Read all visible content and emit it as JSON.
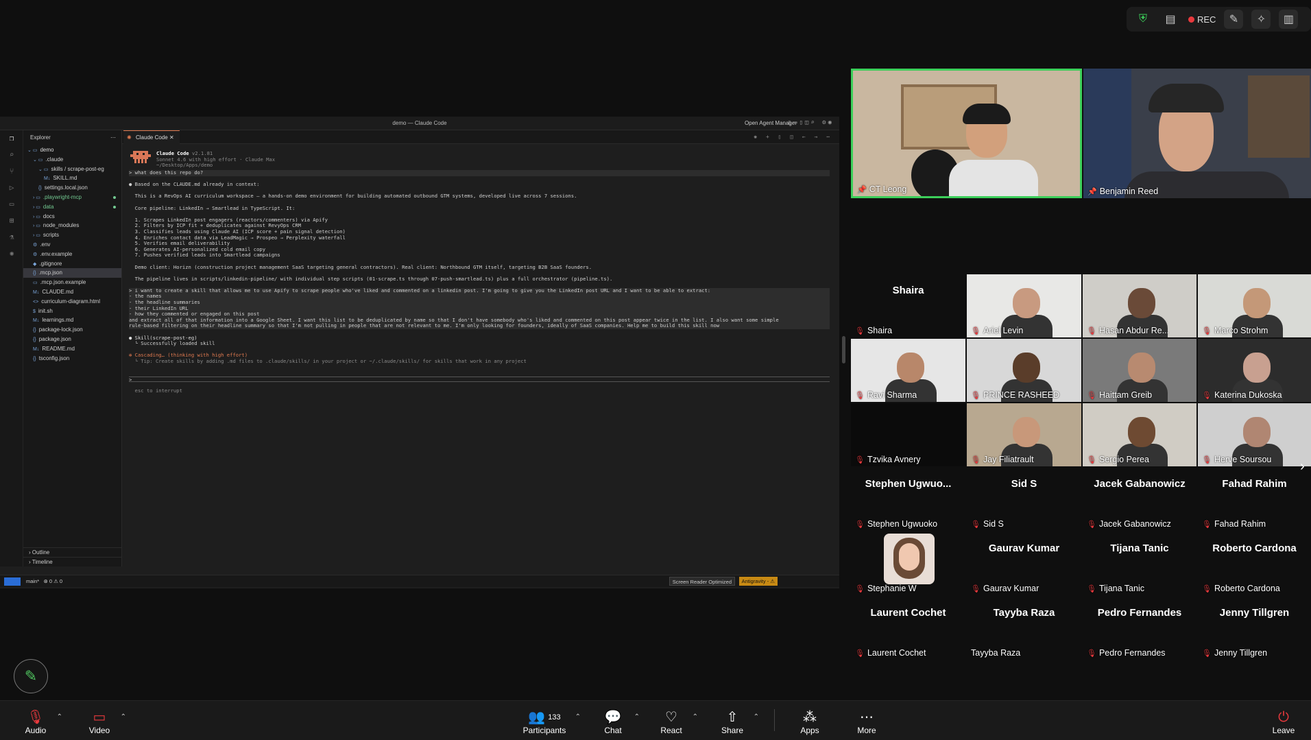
{
  "top_controls": {
    "rec_label": "REC"
  },
  "vscode": {
    "window_title": "demo — Claude Code",
    "open_agent_manager": "Open Agent Manager",
    "explorer_title": "Explorer",
    "tree": [
      {
        "label": "demo",
        "indent": 0,
        "kind": "folder-open"
      },
      {
        "label": ".claude",
        "indent": 1,
        "kind": "folder-open"
      },
      {
        "label": "skills / scrape-post-eg",
        "indent": 2,
        "kind": "folder-open"
      },
      {
        "label": "SKILL.md",
        "indent": 3,
        "kind": "md"
      },
      {
        "label": "settings.local.json",
        "indent": 2,
        "kind": "json"
      },
      {
        "label": ".playwright-mcp",
        "indent": 1,
        "kind": "folder",
        "modified": true
      },
      {
        "label": "data",
        "indent": 1,
        "kind": "folder",
        "modified": true
      },
      {
        "label": "docs",
        "indent": 1,
        "kind": "folder"
      },
      {
        "label": "node_modules",
        "indent": 1,
        "kind": "folder"
      },
      {
        "label": "scripts",
        "indent": 1,
        "kind": "folder"
      },
      {
        "label": ".env",
        "indent": 1,
        "kind": "gear"
      },
      {
        "label": ".env.example",
        "indent": 1,
        "kind": "gear"
      },
      {
        "label": ".gitignore",
        "indent": 1,
        "kind": "git"
      },
      {
        "label": ".mcp.json",
        "indent": 1,
        "kind": "json",
        "selected": true
      },
      {
        "label": ".mcp.json.example",
        "indent": 1,
        "kind": "file"
      },
      {
        "label": "CLAUDE.md",
        "indent": 1,
        "kind": "md"
      },
      {
        "label": "curriculum-diagram.html",
        "indent": 1,
        "kind": "html"
      },
      {
        "label": "init.sh",
        "indent": 1,
        "kind": "sh"
      },
      {
        "label": "learnings.md",
        "indent": 1,
        "kind": "md"
      },
      {
        "label": "package-lock.json",
        "indent": 1,
        "kind": "json"
      },
      {
        "label": "package.json",
        "indent": 1,
        "kind": "json"
      },
      {
        "label": "README.md",
        "indent": 1,
        "kind": "md"
      },
      {
        "label": "tsconfig.json",
        "indent": 1,
        "kind": "json"
      }
    ],
    "outline": "Outline",
    "timeline": "Timeline",
    "tab_label": "Claude Code",
    "header": {
      "name": "Claude Code",
      "version": "v2.1.81",
      "model": "Sonnet 4.6 with high effort · Claude Max",
      "path": "~/Desktop/Apps/demo"
    },
    "conversation": [
      {
        "text": "> what does this repo do?",
        "style": "hl"
      },
      {
        "text": "",
        "style": ""
      },
      {
        "text": "● Based on the CLAUDE.md already in context:",
        "style": ""
      },
      {
        "text": "",
        "style": ""
      },
      {
        "text": "  This is a RevOps AI curriculum workspace — a hands-on demo environment for building automated outbound GTM systems, developed live across 7 sessions.",
        "style": ""
      },
      {
        "text": "",
        "style": ""
      },
      {
        "text": "  Core pipeline: LinkedIn → Smartlead in TypeScript. It:",
        "style": ""
      },
      {
        "text": "",
        "style": ""
      },
      {
        "text": "  1. Scrapes LinkedIn post engagers (reactors/commenters) via Apify",
        "style": ""
      },
      {
        "text": "  2. Filters by ICP fit + deduplicates against RevyOps CRM",
        "style": ""
      },
      {
        "text": "  3. Classifies leads using Claude AI (ICP score + pain signal detection)",
        "style": ""
      },
      {
        "text": "  4. Enriches contact data via LeadMagic → Prospeo → Perplexity waterfall",
        "style": ""
      },
      {
        "text": "  5. Verifies email deliverability",
        "style": ""
      },
      {
        "text": "  6. Generates AI-personalized cold email copy",
        "style": ""
      },
      {
        "text": "  7. Pushes verified leads into Smartlead campaigns",
        "style": ""
      },
      {
        "text": "",
        "style": ""
      },
      {
        "text": "  Demo client: Horizn (construction project management SaaS targeting general contractors). Real client: Northbound GTM itself, targeting B2B SaaS founders.",
        "style": ""
      },
      {
        "text": "",
        "style": ""
      },
      {
        "text": "  The pipeline lives in scripts/linkedin-pipeline/ with individual step scripts (01-scrape.ts through 07-push-smartlead.ts) plus a full orchestrator (pipeline.ts).",
        "style": ""
      },
      {
        "text": "",
        "style": ""
      },
      {
        "text": "> i want to create a skill that allows me to use Apify to scrape people who've liked and commented on a linkedin post. I'm going to give you the LinkedIn post URL and I want to be able to extract:",
        "style": "hl"
      },
      {
        "text": "- the names",
        "style": "hl"
      },
      {
        "text": "- the headline summaries",
        "style": "hl"
      },
      {
        "text": "- their LinkedIn URL",
        "style": "hl"
      },
      {
        "text": "- how they commented or engaged on this post",
        "style": "hl"
      },
      {
        "text": "and extract all of that information into a Google Sheet. I want this list to be deduplicated by name so that I don't have somebody who's liked and commented on this post appear twice in the list. I also want some simple",
        "style": "hl"
      },
      {
        "text": "rule-based filtering on their headline summary so that I'm not pulling in people that are not relevant to me. I'm only looking for founders, ideally of SaaS companies. Help me to build this skill now",
        "style": "hl"
      },
      {
        "text": "",
        "style": ""
      },
      {
        "text": "● Skill(scrape-post-eg)",
        "style": "skill"
      },
      {
        "text": "  └ Successfully loaded skill",
        "style": ""
      },
      {
        "text": "",
        "style": ""
      },
      {
        "text": "✻ Cascading… (thinking with high effort)",
        "style": "casc"
      },
      {
        "text": "  └ Tip: Create skills by adding .md files to .claude/skills/ in your project or ~/.claude/skills/ for skills that work in any project",
        "style": "dim"
      },
      {
        "text": "",
        "style": ""
      },
      {
        "text": "",
        "style": ""
      },
      {
        "text": ">",
        "style": "inp"
      },
      {
        "text": "",
        "style": ""
      },
      {
        "text": "  esc to interrupt",
        "style": "dim"
      }
    ],
    "status": {
      "branch": "main*",
      "problems": "⊗ 0 ⚠ 0",
      "screen_reader": "Screen Reader Optimized",
      "antigravity": "Antigravity - ⚠"
    }
  },
  "speakers": [
    {
      "name": "CT Leong",
      "active": true
    },
    {
      "name": "Benjamin Reed",
      "active": false
    }
  ],
  "gallery": [
    {
      "name": "Shaira",
      "big": "Shaira",
      "video": false
    },
    {
      "name": "Ariel Levin",
      "video": true,
      "wall": "#e8e8e6",
      "skin": "#c89a80"
    },
    {
      "name": "Hasan Abdur Re...",
      "video": true,
      "wall": "#cfcdc8",
      "skin": "#6a4a38"
    },
    {
      "name": "Marco Strohm",
      "video": true,
      "wall": "#d9dad6",
      "skin": "#c49878"
    },
    {
      "name": "Ravi Sharma",
      "video": true,
      "wall": "#e6e6e6",
      "skin": "#b8876a"
    },
    {
      "name": "PRINCE RASHEED",
      "video": true,
      "wall": "#d8d8d8",
      "skin": "#5a3d2a"
    },
    {
      "name": "Haittam Greib",
      "video": true,
      "wall": "#7a7a7a",
      "skin": "#b88a70"
    },
    {
      "name": "Katerina Dukoska",
      "video": true,
      "wall": "#2c2c2c",
      "skin": "#c8a090"
    },
    {
      "name": "Tzvika Avnery",
      "video": true,
      "wall": "#0b0b0b",
      "skin": "#0b0b0b"
    },
    {
      "name": "Jay Filiatrault",
      "video": true,
      "wall": "#b8a890",
      "skin": "#c8987a"
    },
    {
      "name": "Sergio Perea",
      "video": true,
      "wall": "#d0ccc4",
      "skin": "#6e4a32"
    },
    {
      "name": "Herve Soursou",
      "video": true,
      "wall": "#cfcfcf",
      "skin": "#b08672"
    },
    {
      "name": "Stephen Ugwuoko",
      "big": "Stephen  Ugwuo...",
      "video": false
    },
    {
      "name": "Sid S",
      "big": "Sid S",
      "video": false
    },
    {
      "name": "Jacek Gabanowicz",
      "big": "Jacek Gabanowicz",
      "video": false
    },
    {
      "name": "Fahad Rahim",
      "big": "Fahad Rahim",
      "video": false
    },
    {
      "name": "Stephanie W",
      "big": "",
      "video": false,
      "photo": true
    },
    {
      "name": "Gaurav Kumar",
      "big": "Gaurav Kumar",
      "video": false
    },
    {
      "name": "Tijana Tanic",
      "big": "Tijana Tanic",
      "video": false
    },
    {
      "name": "Roberto Cardona",
      "big": "Roberto Cardona",
      "video": false
    },
    {
      "name": "Laurent Cochet",
      "big": "Laurent Cochet",
      "video": false
    },
    {
      "name": "Tayyba Raza",
      "big": "Tayyba Raza",
      "video": false,
      "nomute": true
    },
    {
      "name": "Pedro Fernandes",
      "big": "Pedro Fernandes",
      "video": false
    },
    {
      "name": "Jenny Tillgren",
      "big": "Jenny Tillgren",
      "video": false
    }
  ],
  "toolbar": {
    "audio": "Audio",
    "video": "Video",
    "participants": "Participants",
    "participants_count": "133",
    "chat": "Chat",
    "react": "React",
    "share": "Share",
    "apps": "Apps",
    "more": "More",
    "leave": "Leave"
  },
  "colors": {
    "active_speaker": "#3ccf5a",
    "mute": "#e8393d",
    "accent_orange": "#e07a50",
    "link": "#5aa9e6"
  }
}
